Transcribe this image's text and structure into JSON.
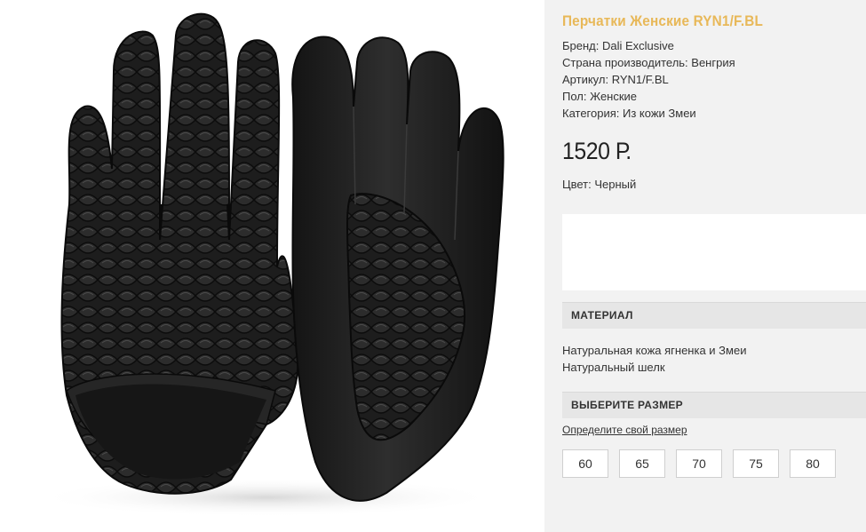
{
  "product": {
    "image_alt": "gloves-photo",
    "title": "Перчатки Женские RYN1/F.BL",
    "specs": [
      "Бренд: Dali Exclusive",
      "Страна производитель: Венгрия",
      "Артикул: RYN1/F.BL",
      "Пол: Женские",
      "Категория: Из кожи Змеи"
    ],
    "price": "1520 Р.",
    "color": "Цвет: Черный"
  },
  "material": {
    "heading": "МАТЕРИАЛ",
    "lines": [
      "Натуральная кожа ягненка и Змеи",
      "Натуральный шелк"
    ]
  },
  "size": {
    "heading": "ВЫБЕРИТЕ РАЗМЕР",
    "link": "Определите свой размер",
    "options": [
      "60",
      "65",
      "70",
      "75",
      "80"
    ]
  },
  "colors": {
    "title": "#e8b858",
    "panel": "#f2f2f2",
    "section_head": "#e6e6e6",
    "glove": "#1c1c1c"
  }
}
